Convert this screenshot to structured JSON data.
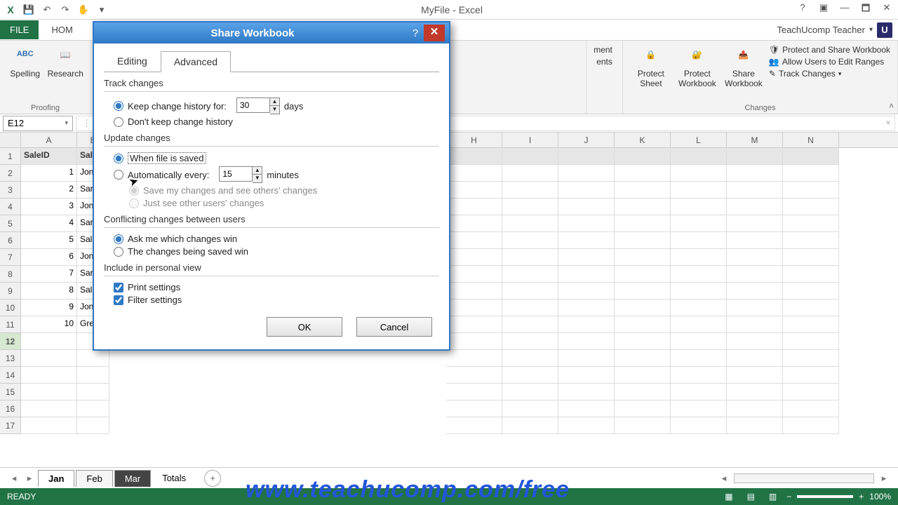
{
  "app": {
    "title": "MyFile - Excel",
    "signin": "TeachUcomp Teacher",
    "avatar": "U"
  },
  "qat": {
    "undo_glyph": "↶",
    "redo_glyph": "↷",
    "touch_glyph": "✋",
    "more_glyph": "▾"
  },
  "tabs": {
    "file": "FILE",
    "home": "HOM"
  },
  "ribbon": {
    "proofing": {
      "spelling": "Spelling",
      "research": "Research",
      "label": "Proofing",
      "abc": "ABC"
    },
    "changes": {
      "protect_sheet": "Protect Sheet",
      "protect_workbook": "Protect Workbook",
      "share_workbook": "Share Workbook",
      "protect_share": "Protect and Share Workbook",
      "allow_edit": "Allow Users to Edit Ranges",
      "track_changes": "Track Changes",
      "label": "Changes",
      "partial1": "ment",
      "partial2": "ents"
    }
  },
  "namebox": "E12",
  "columns": [
    "A",
    "B",
    "H",
    "I",
    "J",
    "K",
    "L",
    "M",
    "N"
  ],
  "colB_head": "Sales",
  "table": {
    "headers": {
      "a": "SaleID",
      "b": "Sales"
    },
    "rows": [
      {
        "n": "1",
        "a": "SaleID",
        "b": "Sales"
      },
      {
        "n": "2",
        "a": "1",
        "b": "Jon S"
      },
      {
        "n": "3",
        "a": "2",
        "b": "Sara"
      },
      {
        "n": "4",
        "a": "3",
        "b": "Jon S"
      },
      {
        "n": "5",
        "a": "4",
        "b": "Sara"
      },
      {
        "n": "6",
        "a": "5",
        "b": "Sally"
      },
      {
        "n": "7",
        "a": "6",
        "b": "Jon S"
      },
      {
        "n": "8",
        "a": "7",
        "b": "Sara"
      },
      {
        "n": "9",
        "a": "8",
        "b": "Sally"
      },
      {
        "n": "10",
        "a": "9",
        "b": "Jon S"
      },
      {
        "n": "11",
        "a": "10",
        "b": "Greg"
      },
      {
        "n": "12",
        "a": "",
        "b": ""
      },
      {
        "n": "13",
        "a": "",
        "b": ""
      },
      {
        "n": "14",
        "a": "",
        "b": ""
      },
      {
        "n": "15",
        "a": "",
        "b": ""
      },
      {
        "n": "16",
        "a": "",
        "b": ""
      },
      {
        "n": "17",
        "a": "",
        "b": ""
      }
    ]
  },
  "sheets": {
    "s1": "Jan",
    "s2": "Feb",
    "s3": "Mar",
    "s4": "Totals",
    "add": "+"
  },
  "status": {
    "ready": "READY",
    "zoom": "100%"
  },
  "dialog": {
    "title": "Share Workbook",
    "tab_editing": "Editing",
    "tab_advanced": "Advanced",
    "track": {
      "title": "Track changes",
      "keep": "Keep change history for:",
      "days_val": "30",
      "days": "days",
      "dont": "Don't keep change history"
    },
    "update": {
      "title": "Update changes",
      "when": "When file is saved",
      "auto": "Automatically every:",
      "mins_val": "15",
      "mins": "minutes",
      "save_see": "Save my changes and see others' changes",
      "just_see": "Just see other users' changes"
    },
    "conflict": {
      "title": "Conflicting changes between users",
      "ask": "Ask me which changes win",
      "saved": "The changes being saved win"
    },
    "include": {
      "title": "Include in personal view",
      "print": "Print settings",
      "filter": "Filter settings"
    },
    "ok": "OK",
    "cancel": "Cancel"
  },
  "overlay_url": "www.teachucomp.com/free"
}
